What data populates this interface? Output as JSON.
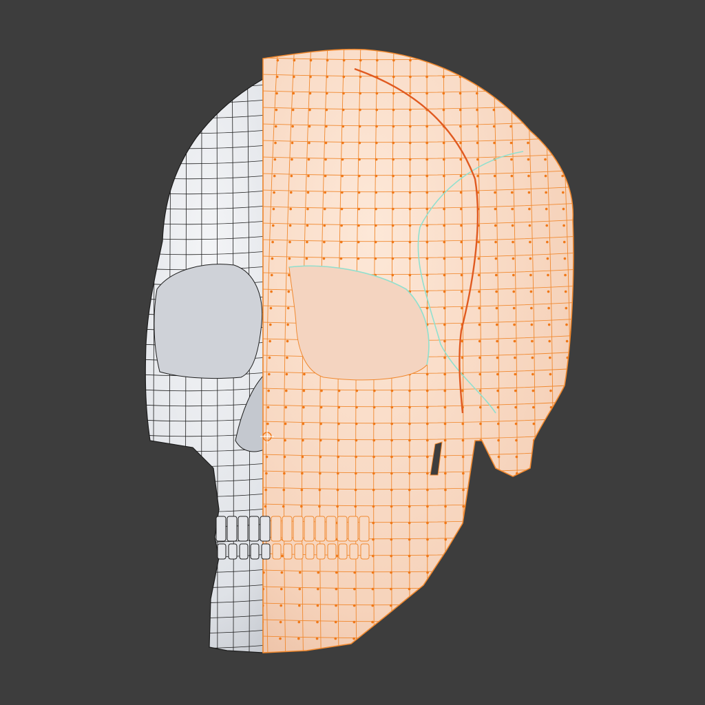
{
  "viewport": {
    "background": "#3d3d3d",
    "mode": "edit-mode",
    "mesh_name": "",
    "selection": "right-half"
  },
  "colors": {
    "unselected_face": "#e4e6ea",
    "unselected_wire": "#1c1c1c",
    "selected_face": "#f8d9c3",
    "selected_wire": "#f0882e",
    "selected_vertex": "#f07818",
    "active_edge": "#e05a20",
    "seam": "#8fe0cf",
    "shadow": "#a9aeb6"
  },
  "icons": {
    "origin": "origin-icon"
  }
}
